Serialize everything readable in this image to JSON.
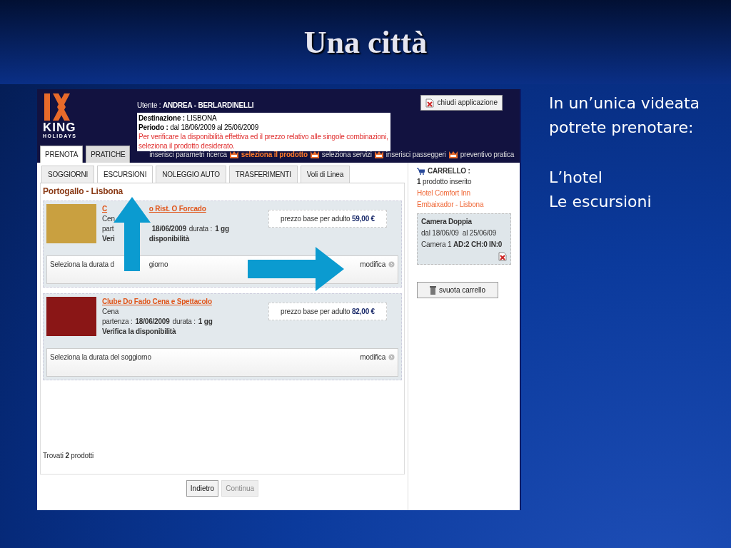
{
  "slide": {
    "title": "Una città",
    "bullets": [
      "In un’unica videata potrete prenotare:",
      "L’hotel",
      "Le escursioni"
    ]
  },
  "app": {
    "user_label": "Utente :",
    "user": "ANDREA - BERLARDINELLI",
    "destination_label": "Destinazione :",
    "destination": "LISBONA",
    "period_label": "Periodo :",
    "period": "dal 18/06/2009 al 25/06/2009",
    "notice": "Per verificare la disponibilità effettiva ed il prezzo relativo alle singole combinazioni, seleziona il prodotto desiderato.",
    "close_button": "chiudi applicazione",
    "logo": {
      "name": "KING",
      "tagline": "HOLIDAYS"
    },
    "main_tabs": [
      {
        "label": "PRENOTA",
        "selected": true
      },
      {
        "label": "PRATICHE",
        "selected": false
      }
    ],
    "steps": [
      {
        "label": "inserisci parametri ricerca",
        "selected": false
      },
      {
        "label": "seleziona il prodotto",
        "selected": true
      },
      {
        "label": "seleziona servizi",
        "selected": false
      },
      {
        "label": "inserisci passeggeri",
        "selected": false
      },
      {
        "label": "preventivo pratica",
        "selected": false
      }
    ],
    "sub_tabs": [
      {
        "label": "SOGGIORNI",
        "selected": false
      },
      {
        "label": "ESCURSIONI",
        "selected": true
      },
      {
        "label": "NOLEGGIO AUTO",
        "selected": false
      },
      {
        "label": "TRASFERIMENTI",
        "selected": false
      },
      {
        "label": "Voli di Linea",
        "selected": false
      }
    ],
    "heading": "Portogallo - Lisbona",
    "products": [
      {
        "covered": true,
        "title": [
          "C",
          "o Rist. O Forcado"
        ],
        "category": [
          "Cen"
        ],
        "departure_label": [
          "part"
        ],
        "departure": "18/06/2009",
        "duration_label": "durata :",
        "duration": "1 gg",
        "verify": [
          "Veri",
          "disponibilità"
        ],
        "price_label": "prezzo base per adulto",
        "price": "59,00 €",
        "duration_prompt": [
          "Seleziona la durata d",
          "giorno"
        ],
        "modify": "modifica"
      },
      {
        "covered": false,
        "title": [
          "Clube Do Fado Cena e Spettacolo"
        ],
        "category": [
          "Cena"
        ],
        "departure_label": [
          "partenza :"
        ],
        "departure": "18/06/2009",
        "duration_label": "durata :",
        "duration": "1 gg",
        "verify": [
          "Verifica la disponibilità"
        ],
        "price_label": "prezzo base per adulto",
        "price": "82,00 €",
        "duration_prompt": [
          "Seleziona la durata del soggiorno"
        ],
        "modify": "modifica"
      }
    ],
    "found": "Trovati **2** prodotti",
    "buttons": [
      {
        "label": "Indietro",
        "disabled": false
      },
      {
        "label": "Continua",
        "disabled": true
      }
    ],
    "cart": {
      "title": "CARRELLO :",
      "count": "**1** prodotto inserito",
      "hotel": [
        "Hotel Comfort Inn",
        "Embaixador - Lisbona"
      ],
      "room": {
        "name": "Camera Doppia",
        "dates": "dal 18/06/09  al 25/06/09",
        "occupancy": "Camera 1 **AD:2 CH:0 IN:0**"
      },
      "empty_button": "svuota carrello"
    }
  }
}
